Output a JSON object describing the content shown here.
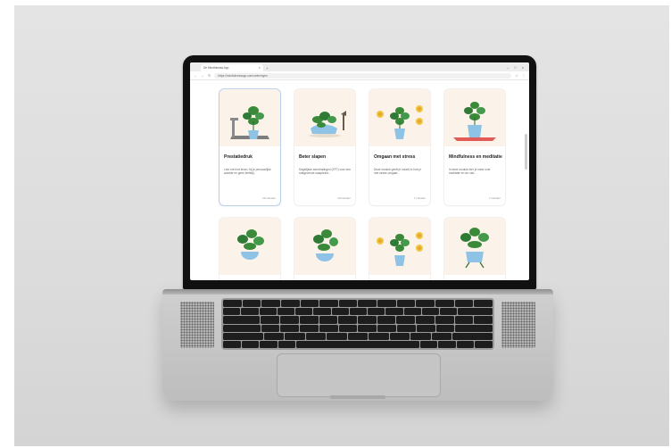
{
  "browser": {
    "tab_title": "De Mindfulness App",
    "url": "https://mindfulnessapp.com/oefeningen"
  },
  "cards": [
    {
      "title": "Prestatiedruk",
      "description": "Leer met het leven, bij je persoonlijke waarde en geen leefstijl...",
      "time": "10 minuten"
    },
    {
      "title": "Beter slapen",
      "description": "Dagelijkse ademhalingen (EFT) voor een rustgevende slaaptekst...",
      "time": "10 minuten"
    },
    {
      "title": "Omgaan met stress",
      "description": "Deze module geeft je inzicht in hoe je met stress omgaat...",
      "time": "7 minuten"
    },
    {
      "title": "Mindfulness en meditatie",
      "description": "In deze module leer je meer over meditatie en de rust...",
      "time": "7 minuten"
    }
  ],
  "colors": {
    "pot_blue": "#8ec3e6",
    "leaf_green": "#3b8a3a",
    "card_bg": "#fbf3ea",
    "coin_yellow": "#f2c443",
    "mat_red": "#e25c57"
  }
}
